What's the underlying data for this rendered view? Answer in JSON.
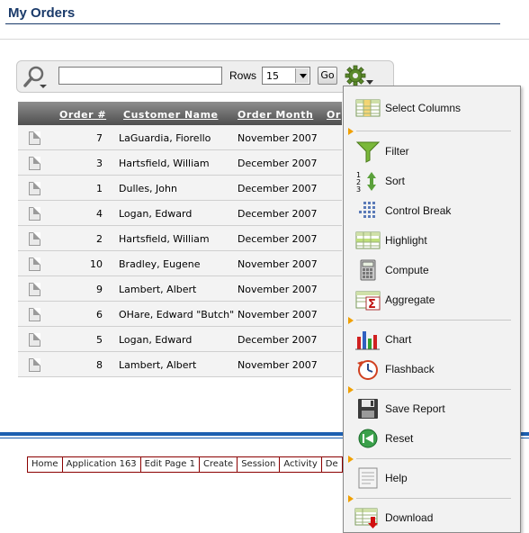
{
  "page": {
    "title": "My Orders"
  },
  "search": {
    "placeholder": "",
    "value": "",
    "rows_label": "Rows",
    "rows_value": "15",
    "go_label": "Go"
  },
  "report": {
    "columns": [
      "Order #",
      "Customer Name",
      "Order Month",
      "Or"
    ],
    "rows": [
      {
        "order": "7",
        "customer": "LaGuardia, Fiorello",
        "month": "November 2007"
      },
      {
        "order": "3",
        "customer": "Hartsfield, William",
        "month": "December 2007"
      },
      {
        "order": "1",
        "customer": "Dulles, John",
        "month": "December 2007"
      },
      {
        "order": "4",
        "customer": "Logan, Edward",
        "month": "December 2007"
      },
      {
        "order": "2",
        "customer": "Hartsfield, William",
        "month": "December 2007"
      },
      {
        "order": "10",
        "customer": "Bradley, Eugene",
        "month": "November 2007"
      },
      {
        "order": "9",
        "customer": "Lambert, Albert",
        "month": "November 2007"
      },
      {
        "order": "6",
        "customer": "OHare, Edward \"Butch\"",
        "month": "November 2007"
      },
      {
        "order": "5",
        "customer": "Logan, Edward",
        "month": "December 2007"
      },
      {
        "order": "8",
        "customer": "Lambert, Albert",
        "month": "November 2007"
      }
    ]
  },
  "actions_menu": {
    "items": [
      {
        "label": "Select Columns",
        "icon": "select-columns-icon"
      },
      {
        "label": "Filter",
        "icon": "filter-icon"
      },
      {
        "label": "Sort",
        "icon": "sort-icon"
      },
      {
        "label": "Control Break",
        "icon": "control-break-icon"
      },
      {
        "label": "Highlight",
        "icon": "highlight-icon"
      },
      {
        "label": "Compute",
        "icon": "compute-icon"
      },
      {
        "label": "Aggregate",
        "icon": "aggregate-icon"
      },
      {
        "label": "Chart",
        "icon": "chart-icon"
      },
      {
        "label": "Flashback",
        "icon": "flashback-icon"
      },
      {
        "label": "Save Report",
        "icon": "save-icon"
      },
      {
        "label": "Reset",
        "icon": "reset-icon"
      },
      {
        "label": "Help",
        "icon": "help-icon"
      },
      {
        "label": "Download",
        "icon": "download-icon"
      }
    ]
  },
  "developer_toolbar": {
    "links": [
      "Home",
      "Application 163",
      "Edit Page 1",
      "Create",
      "Session",
      "Activity",
      "De"
    ]
  },
  "colors": {
    "title": "#1a3a6a",
    "accent_blue": "#1c5fb0",
    "toolbar_border": "#8b0000",
    "submenu_arrow": "#f0a000"
  }
}
